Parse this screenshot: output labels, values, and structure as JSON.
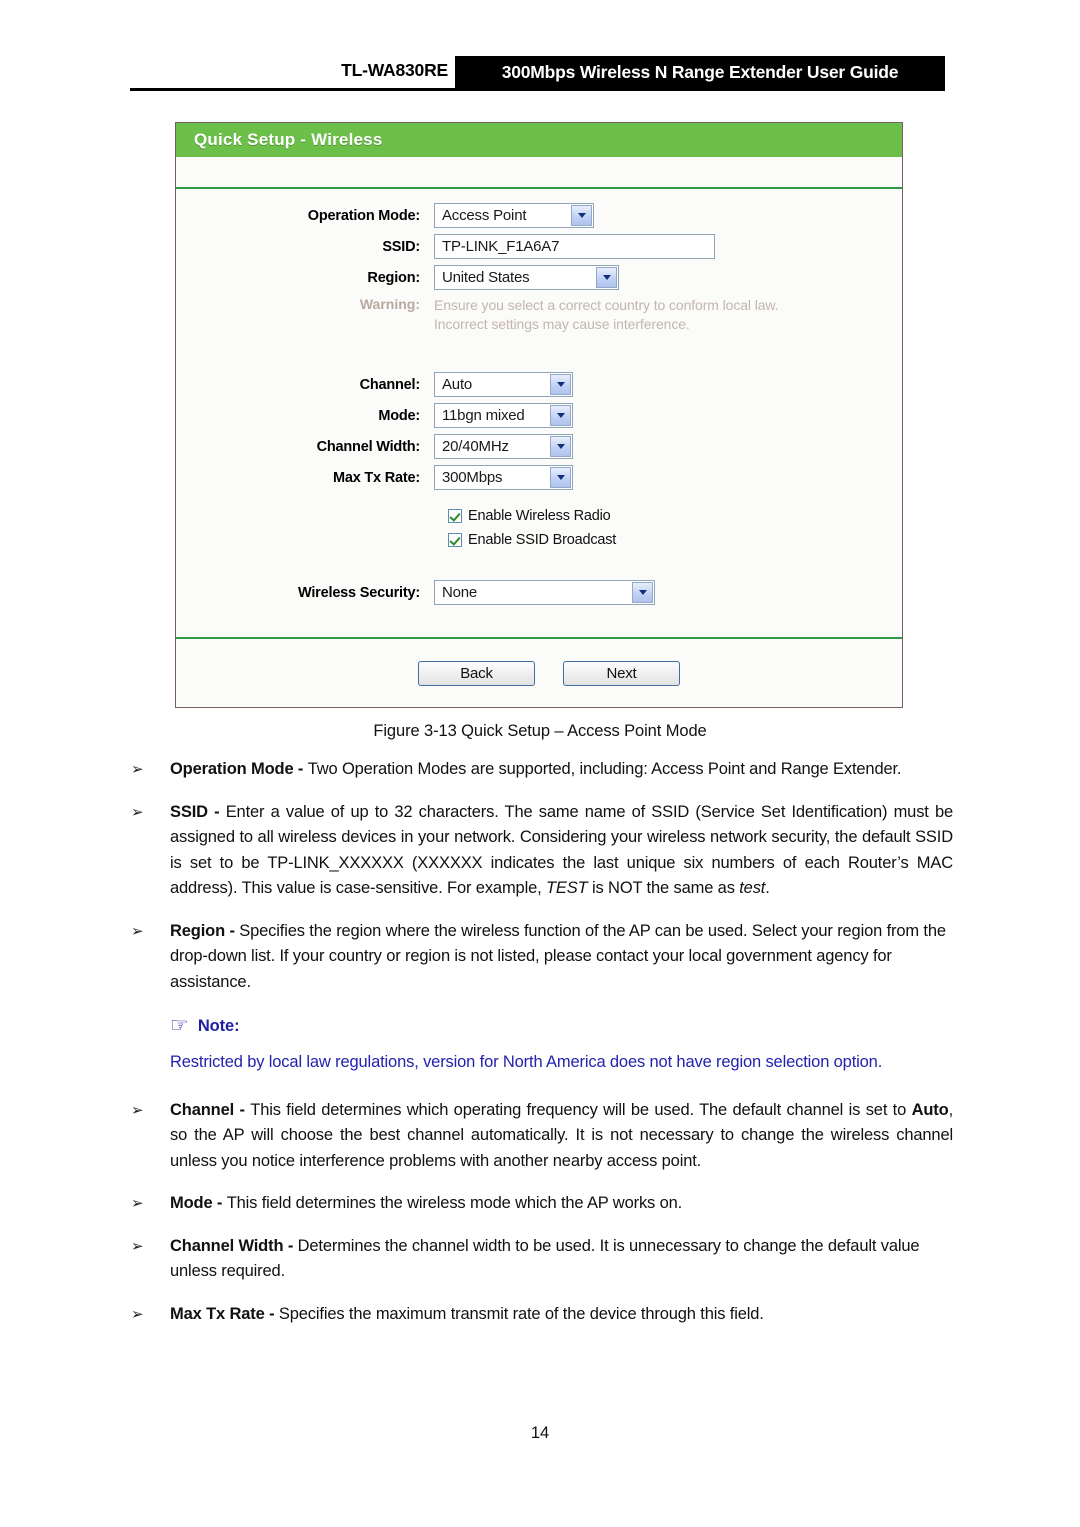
{
  "page_header": {
    "model": "TL-WA830RE",
    "title": "300Mbps Wireless N Range Extender User Guide"
  },
  "ui_panel": {
    "title": "Quick Setup - Wireless",
    "fields": {
      "operation_mode": {
        "label": "Operation Mode:",
        "value": "Access Point"
      },
      "ssid": {
        "label": "SSID:",
        "value": "TP-LINK_F1A6A7"
      },
      "region": {
        "label": "Region:",
        "value": "United States"
      },
      "warning": {
        "label": "Warning:",
        "line1": "Ensure you select a correct country to conform local law.",
        "line2": "Incorrect settings may cause interference."
      },
      "channel": {
        "label": "Channel:",
        "value": "Auto"
      },
      "mode": {
        "label": "Mode:",
        "value": "11bgn mixed"
      },
      "channel_width": {
        "label": "Channel Width:",
        "value": "20/40MHz"
      },
      "max_tx_rate": {
        "label": "Max Tx Rate:",
        "value": "300Mbps"
      },
      "enable_wireless_radio": {
        "label": "Enable Wireless Radio",
        "checked": "true"
      },
      "enable_ssid_broadcast": {
        "label": "Enable SSID Broadcast",
        "checked": "true"
      },
      "wireless_security": {
        "label": "Wireless Security:",
        "value": "None"
      }
    },
    "buttons": {
      "back": "Back",
      "next": "Next"
    },
    "colors": {
      "title_bar": "#6cc04a",
      "separator": "#2e9b48",
      "panel_border": "#7a5f5f"
    }
  },
  "figure_caption": "Figure 3-13 Quick Setup – Access Point Mode",
  "bullets": [
    {
      "mark": "➢",
      "term": "Operation Mode - ",
      "text": "Two Operation Modes are supported, including: Access Point and Range Extender."
    },
    {
      "mark": "➢",
      "term": "SSID - ",
      "text_a": "Enter a value of up to 32 characters. The same name of SSID (Service Set Identification) must be assigned to all wireless devices in your network. Considering your wireless network security, the default SSID is set to be TP-LINK_XXXXXX (XXXXXX indicates the last unique six numbers of each Router’s MAC address). This value is case-sensitive. For example, ",
      "italic_a": "TEST",
      "text_b": " is NOT the same as ",
      "italic_b": "test",
      "text_c": "."
    },
    {
      "mark": "➢",
      "term": "Region - ",
      "text": "Specifies the region where the wireless function of the AP can be used. Select your region from the drop-down list. If your country or region is not listed, please contact your local government agency for assistance."
    }
  ],
  "note": {
    "icon": "☞",
    "title": "Note:",
    "body": "Restricted by local law regulations, version for North America does not have region selection option.",
    "color": "#2222b0"
  },
  "bullets_after_note": [
    {
      "mark": "➢",
      "term": "Channel - ",
      "text_a": "This field determines which operating frequency will be used. The default channel is set to ",
      "bold_a": "Auto",
      "text_b": ", so the AP will choose the best channel automatically. It is not necessary to change the wireless channel unless you notice interference problems with another nearby access point."
    },
    {
      "mark": "➢",
      "term": "Mode - ",
      "text": "This field determines the wireless mode which the AP works on."
    },
    {
      "mark": "➢",
      "term": "Channel Width - ",
      "text": "Determines the channel width to be used. It is unnecessary to change the default value unless required."
    },
    {
      "mark": "➢",
      "term": "Max Tx Rate - ",
      "text": "Specifies the maximum transmit rate of the device through this field."
    }
  ],
  "page_number": "14"
}
